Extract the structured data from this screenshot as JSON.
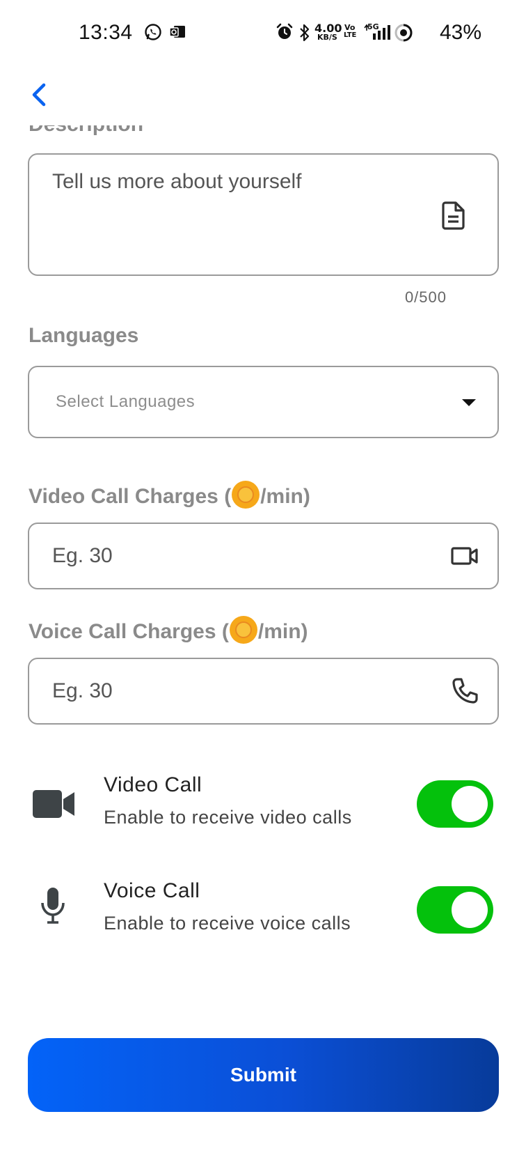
{
  "status_bar": {
    "time": "13:34",
    "net_speed_value": "4.00",
    "net_speed_unit": "KB/S",
    "volte_top": "Vo",
    "volte_bottom": "LTE",
    "network_type": "5G",
    "battery_percent": "43%"
  },
  "header": {
    "back_icon": "chevron-left-icon"
  },
  "form": {
    "description": {
      "label": "Description",
      "placeholder": "Tell us more about yourself",
      "icon": "document-icon",
      "counter": "0/500"
    },
    "languages": {
      "label": "Languages",
      "placeholder": "Select Languages",
      "icon": "dropdown-arrow-icon"
    },
    "video_charges": {
      "label_prefix": "Video Call Charges (",
      "label_suffix": "/min)",
      "placeholder": "Eg. 30",
      "icon": "video-camera-icon"
    },
    "voice_charges": {
      "label_prefix": "Voice Call Charges (",
      "label_suffix": "/min)",
      "placeholder": "Eg. 30",
      "icon": "phone-icon"
    }
  },
  "toggles": [
    {
      "title": "Video Call",
      "subtitle": "Enable to receive video calls",
      "icon": "video-camera-icon",
      "enabled": true
    },
    {
      "title": "Voice Call",
      "subtitle": "Enable to receive voice calls",
      "icon": "microphone-icon",
      "enabled": true
    }
  ],
  "submit": {
    "label": "Submit"
  },
  "colors": {
    "accent": "#0363F8",
    "toggle_on": "#04C10C",
    "label_gray": "#8A8A8A",
    "coin": "#F6A81A"
  }
}
